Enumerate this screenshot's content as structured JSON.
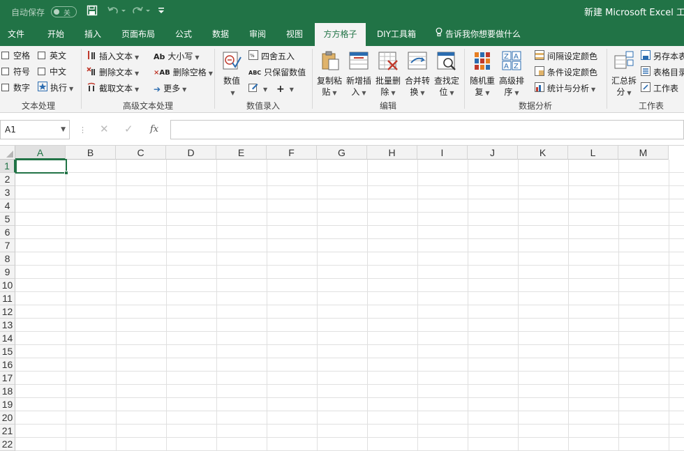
{
  "titlebar": {
    "autosave_label": "自动保存",
    "autosave_state": "关",
    "doc_title": "新建 Microsoft Excel 工作表"
  },
  "tabs": [
    {
      "label": "文件"
    },
    {
      "label": "开始"
    },
    {
      "label": "插入"
    },
    {
      "label": "页面布局"
    },
    {
      "label": "公式"
    },
    {
      "label": "数据"
    },
    {
      "label": "审阅"
    },
    {
      "label": "视图"
    },
    {
      "label": "方方格子",
      "active": true
    },
    {
      "label": "DIY工具箱"
    }
  ],
  "tell_me": "告诉我你想要做什么",
  "ribbon": {
    "text_group": {
      "label": "文本处理",
      "space": "空格",
      "english": "英文",
      "symbol": "符号",
      "chinese": "中文",
      "number": "数字",
      "execute": "执行"
    },
    "adv_text_group": {
      "label": "高级文本处理",
      "insert_text": "插入文本",
      "delete_text": "删除文本",
      "extract_text": "截取文本",
      "case": "大小写",
      "delete_space": "删除空格",
      "more": "更多"
    },
    "num_group": {
      "label": "数值录入",
      "value": "数值",
      "round": "四舍五入",
      "keep_value": "只保留数值"
    },
    "edit_group": {
      "label": "编辑",
      "copy_paste_1": "复制粘",
      "copy_paste_2": "贴",
      "add_insert_1": "新增插",
      "add_insert_2": "入",
      "batch_delete_1": "批量删",
      "batch_delete_2": "除",
      "merge_1": "合并转",
      "merge_2": "换",
      "find_1": "查找定",
      "find_2": "位"
    },
    "analysis_group": {
      "label": "数据分析",
      "random_1": "随机重",
      "random_2": "复",
      "sort_1": "高级排",
      "sort_2": "序",
      "interval_color": "间隔设定颜色",
      "cond_color": "条件设定颜色",
      "stats": "统计与分析"
    },
    "sheet_group": {
      "label": "工作表",
      "summary_1": "汇总拆",
      "summary_2": "分",
      "save_as": "另存本表",
      "sheet_dir": "表格目录",
      "sheet": "工作表"
    }
  },
  "formula_bar": {
    "name_box": "A1",
    "fx": "fx",
    "value": ""
  },
  "grid": {
    "columns": [
      "A",
      "B",
      "C",
      "D",
      "E",
      "F",
      "G",
      "H",
      "I",
      "J",
      "K",
      "L",
      "M"
    ],
    "rows": [
      "1",
      "2",
      "3",
      "4",
      "5",
      "6",
      "7",
      "8",
      "9",
      "10",
      "11",
      "12",
      "13",
      "14",
      "15",
      "16",
      "17",
      "18",
      "19",
      "20",
      "21",
      "22"
    ],
    "selected_cell": "A1"
  },
  "colors": {
    "accent": "#217346",
    "ribbon_bg": "#f3f3f3"
  }
}
